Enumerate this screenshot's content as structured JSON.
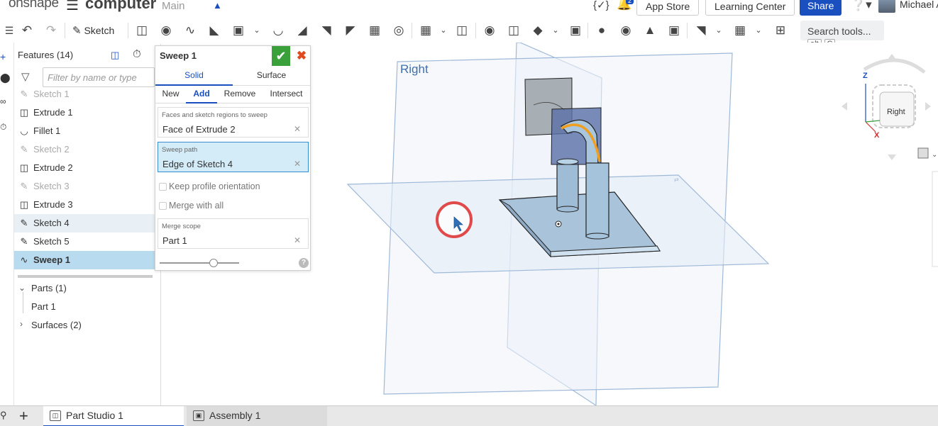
{
  "header": {
    "logo": "onshape",
    "doc_name": "computer",
    "workspace": "Main",
    "buttons": {
      "app_store": "App Store",
      "learning_center": "Learning Center",
      "share": "Share",
      "user": "Michael A"
    },
    "notification_count": "2"
  },
  "toolbar": {
    "sketch_label": "Sketch",
    "search_label": "Search tools...",
    "search_key1": "alt",
    "search_key2": "C"
  },
  "features": {
    "title": "Features (14)",
    "filter_placeholder": "Filter by name or type",
    "items": [
      {
        "label": "Sketch 1",
        "icon": "sketch-icon"
      },
      {
        "label": "Extrude 1",
        "icon": "extrude-icon"
      },
      {
        "label": "Fillet 1",
        "icon": "fillet-icon"
      },
      {
        "label": "Sketch 2",
        "icon": "sketch-icon"
      },
      {
        "label": "Extrude 2",
        "icon": "extrude-icon"
      },
      {
        "label": "Sketch 3",
        "icon": "sketch-icon"
      },
      {
        "label": "Extrude 3",
        "icon": "extrude-icon"
      },
      {
        "label": "Sketch 4",
        "icon": "sketch-icon"
      },
      {
        "label": "Sketch 5",
        "icon": "sketch-icon"
      },
      {
        "label": "Sweep 1",
        "icon": "sweep-icon"
      }
    ],
    "parts_header": "Parts (1)",
    "part_item": "Part 1",
    "surfaces_header": "Surfaces (2)"
  },
  "dialog": {
    "title": "Sweep 1",
    "tabs": [
      "Solid",
      "Surface"
    ],
    "ops": [
      "New",
      "Add",
      "Remove",
      "Intersect"
    ],
    "faces_label": "Faces and sketch regions to sweep",
    "faces_value": "Face of Extrude 2",
    "path_label": "Sweep path",
    "path_value": "Edge of Sketch 4",
    "keep_profile": "Keep profile orientation",
    "merge_all": "Merge with all",
    "merge_scope_label": "Merge scope",
    "merge_scope_value": "Part 1",
    "help": "?"
  },
  "viewport": {
    "plane_label": "Right",
    "viewcube_face": "Right",
    "axis_z": "Z",
    "axis_x": "X"
  },
  "tabs_bottom": {
    "part_studio": "Part Studio 1",
    "assembly": "Assembly 1"
  },
  "colors": {
    "accent": "#1a4fc0",
    "ok": "#3aa03a",
    "cancel": "#e04a1e",
    "path": "#f0a020",
    "plane": "#9fb9d8"
  }
}
